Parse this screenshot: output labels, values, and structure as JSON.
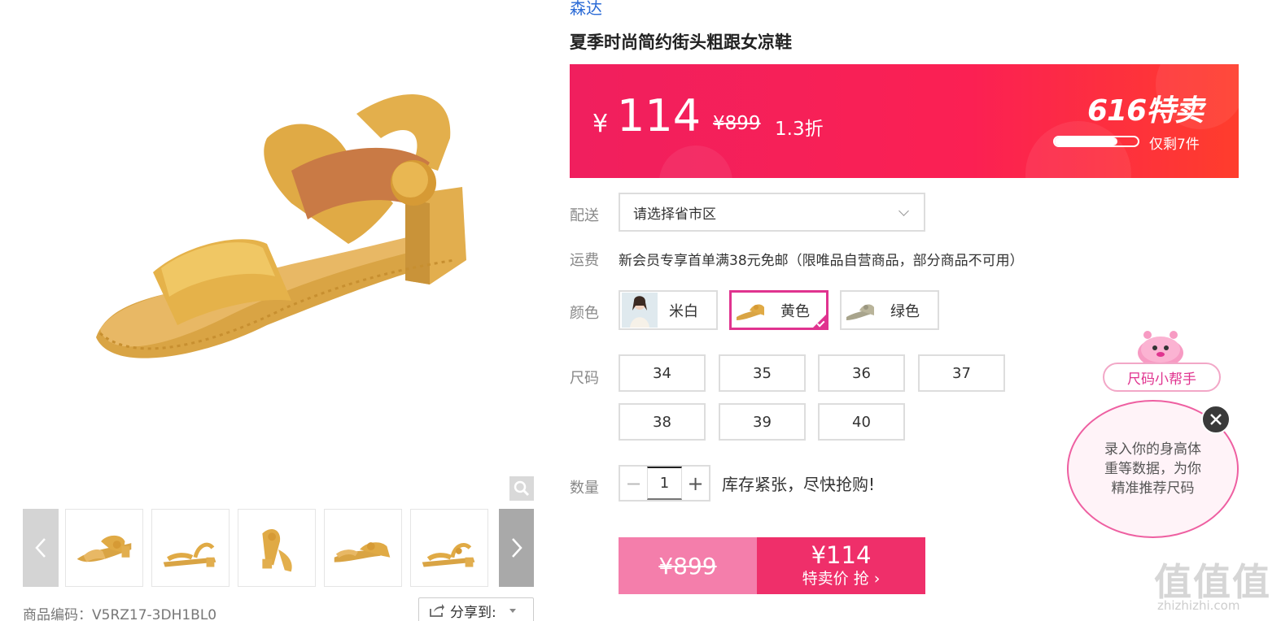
{
  "gallery": {
    "product_code": "商品编码：V5RZ17-3DH1BL0",
    "share_label": "分享到:"
  },
  "product": {
    "brand": "森达",
    "title": "夏季时尚简约街头粗跟女凉鞋"
  },
  "price_banner": {
    "currency": "¥",
    "price": "114",
    "original_price": "¥899",
    "discount": "1.3折",
    "sale_tag": "616特卖",
    "stock_text": "仅剩7件",
    "stock_fill_fraction": 0.75
  },
  "delivery": {
    "label": "配送",
    "placeholder": "请选择省市区"
  },
  "shipping": {
    "label": "运费",
    "text": "新会员专享首单满38元免邮（限唯品自营商品，部分商品不可用）"
  },
  "colors": {
    "label": "颜色",
    "options": [
      {
        "label": "米白",
        "selected": false
      },
      {
        "label": "黄色",
        "selected": true
      },
      {
        "label": "绿色",
        "selected": false
      }
    ]
  },
  "sizes": {
    "label": "尺码",
    "options": [
      "34",
      "35",
      "36",
      "37",
      "38",
      "39",
      "40"
    ]
  },
  "quantity": {
    "label": "数量",
    "value": "1",
    "stock_warning": "库存紧张，尽快抢购!"
  },
  "buy": {
    "original_price": "¥899",
    "price": "¥114",
    "cta": "特卖价 抢 ›"
  },
  "size_helper": {
    "label": "尺码小帮手",
    "bubble_text": "录入你的身高体重等数据，为你精准推荐尺码"
  },
  "watermark": {
    "glyphs": "值值值",
    "url": "zhizhizhi.com"
  },
  "theme": {
    "accent": "#e0338f",
    "banner_red": "#fb2053",
    "brand_blue": "#2b6bd6",
    "shoe_yellow": "#e0b048"
  }
}
